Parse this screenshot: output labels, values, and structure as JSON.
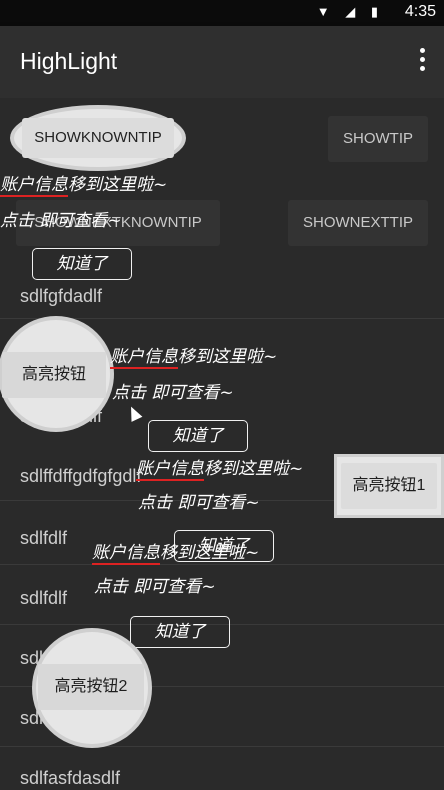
{
  "status": {
    "time": "4:35"
  },
  "appbar": {
    "title": "HighLight"
  },
  "buttons": {
    "show_known_tip": "SHOWKNOWNTIP",
    "show_tip": "SHOWTIP",
    "show_next_known_tip": "SHOWNEXTKNOWNTIP",
    "show_next_tip": "SHOWNEXTTIP",
    "highlight": "高亮按钮",
    "highlight1": "高亮按钮1",
    "highlight2": "高亮按钮2"
  },
  "list": [
    "sdlfgfdadlf",
    "sdlfdgfddlf",
    "sdlffdffgdfgfgdlf",
    "sdlfdlf",
    "sdlfdlf",
    "sdlfadfddlf",
    "sdlfdlf",
    "sdlfasfdasdlf"
  ],
  "tip": {
    "line1_a": "账户信息",
    "line1_b": "移到这里啦~",
    "line2": "点击      即可查看~",
    "ok": "知道了"
  },
  "colors": {
    "accent_underline": "#dd2222"
  }
}
